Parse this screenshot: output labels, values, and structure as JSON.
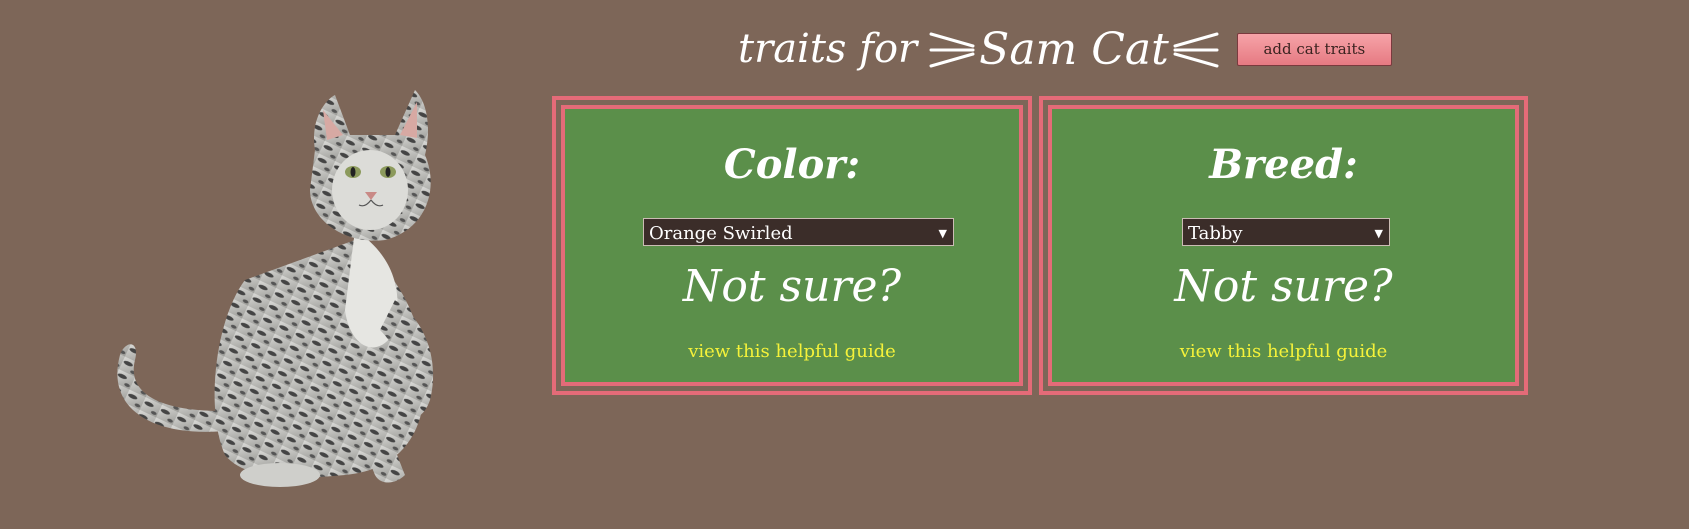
{
  "header": {
    "title_prefix": "traits for",
    "cat_name": "Sam Cat",
    "add_button_label": "add cat traits"
  },
  "panels": {
    "color": {
      "heading": "Color:",
      "selected": "Orange Swirled",
      "not_sure": "Not sure?",
      "guide_link": "view this helpful guide"
    },
    "breed": {
      "heading": "Breed:",
      "selected": "Tabby",
      "not_sure": "Not sure?",
      "guide_link": "view this helpful guide"
    }
  },
  "colors": {
    "background": "#7d6658",
    "panel_green": "#5b8f4a",
    "panel_border": "#e46b78",
    "link_yellow": "#f5f23a",
    "select_bg": "#3b2d29"
  },
  "icons": {
    "left_whiskers": "whiskers-left-icon",
    "right_whiskers": "whiskers-right-icon",
    "select_arrow": "dropdown-arrow-icon",
    "cat_image": "cat-photo"
  }
}
